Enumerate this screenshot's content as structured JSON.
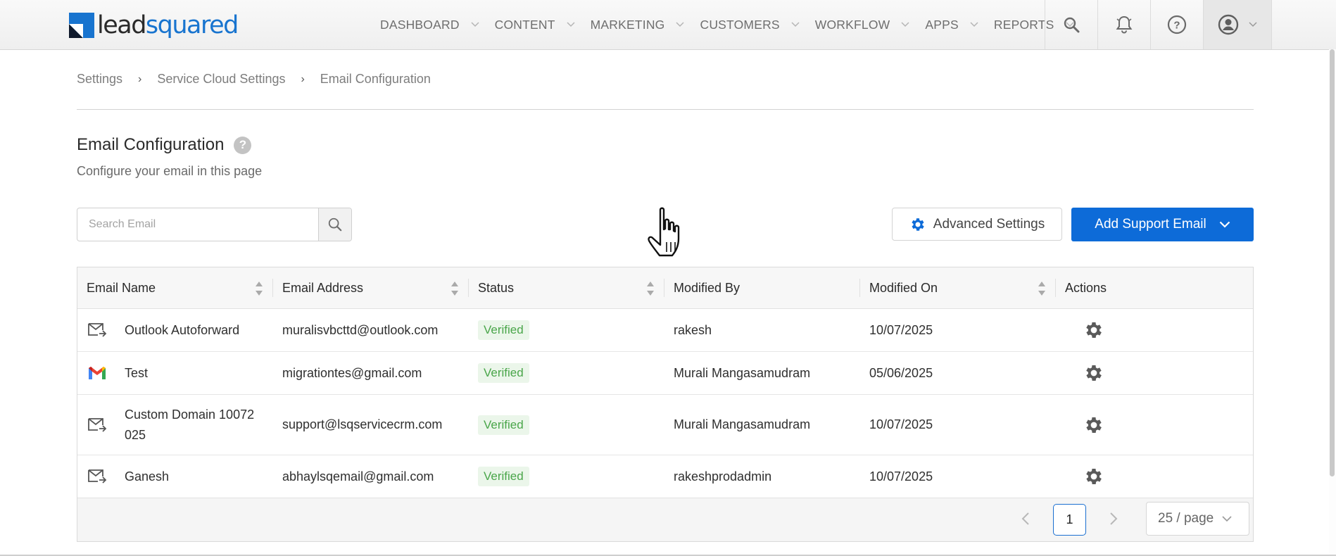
{
  "brand": {
    "name_part1": "lead",
    "name_part2": "squared",
    "color": "#1874cf"
  },
  "nav": {
    "items": [
      {
        "label": "DASHBOARD"
      },
      {
        "label": "CONTENT"
      },
      {
        "label": "MARKETING"
      },
      {
        "label": "CUSTOMERS"
      },
      {
        "label": "WORKFLOW"
      },
      {
        "label": "APPS"
      },
      {
        "label": "REPORTS"
      }
    ],
    "icons": [
      "search-icon",
      "bell-icon",
      "help-icon",
      "user-icon"
    ]
  },
  "breadcrumb": {
    "items": [
      "Settings",
      "Service Cloud Settings",
      "Email Configuration"
    ],
    "separator": "›"
  },
  "page": {
    "title": "Email Configuration",
    "subtitle": "Configure your email in this page",
    "help": "?"
  },
  "search": {
    "placeholder": "Search Email",
    "value": ""
  },
  "actions": {
    "advanced_label": "Advanced Settings",
    "add_label": "Add Support Email",
    "accent": "#0d6bd8"
  },
  "table": {
    "columns": [
      "Email Name",
      "Email Address",
      "Status",
      "Modified By",
      "Modified On",
      "Actions"
    ],
    "rows": [
      {
        "icon": "mail-forward-icon",
        "name": "Outlook Autoforward",
        "address": "muralisvbcttd@outlook.com",
        "status": "Verified",
        "modified_by": "rakesh",
        "modified_on": "10/07/2025"
      },
      {
        "icon": "gmail-icon",
        "name": "Test",
        "address": "migrationtes@gmail.com",
        "status": "Verified",
        "modified_by": "Murali Mangasamudram",
        "modified_on": "05/06/2025"
      },
      {
        "icon": "mail-forward-icon",
        "name_line1": "Custom Domain 10072",
        "name_line2": "025",
        "address": "support@lsqservicecrm.com",
        "status": "Verified",
        "modified_by": "Murali Mangasamudram",
        "modified_on": "10/07/2025"
      },
      {
        "icon": "mail-forward-icon",
        "name": "Ganesh",
        "address": "abhaylsqemail@gmail.com",
        "status": "Verified",
        "modified_by": "rakeshprodadmin",
        "modified_on": "10/07/2025"
      }
    ]
  },
  "pagination": {
    "current_page": "1",
    "page_size": "25 / page"
  }
}
